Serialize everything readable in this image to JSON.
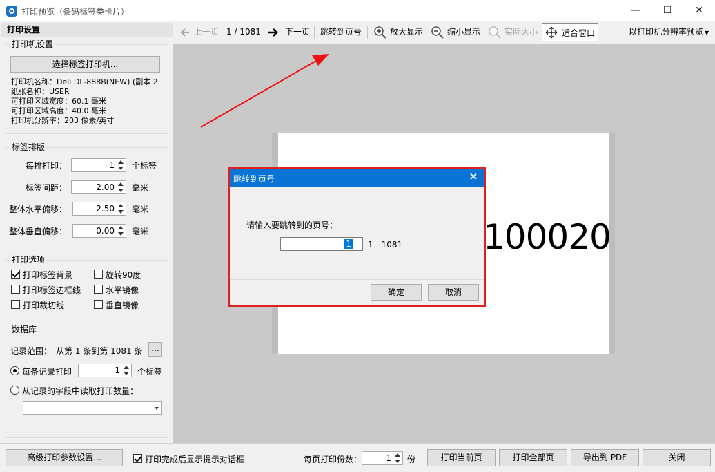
{
  "window": {
    "title": "打印预览（条码标签类卡片）",
    "min": "—",
    "max": "☐",
    "close": "✕"
  },
  "left_panel": {
    "header": "打印设置",
    "printer_group": {
      "title": "打印机设置",
      "select_button": "选择标签打印机...",
      "lines": [
        "打印机名称：Deli DL-888B(NEW) (副本 2",
        "纸张名称：USER",
        "可打印区域宽度：60.1 毫米",
        "可打印区域高度：40.0 毫米",
        "打印机分辨率：203 像素/英寸"
      ]
    },
    "layout_group": {
      "title": "标签排版",
      "rows": [
        {
          "label": "每排打印：",
          "value": "1",
          "unit": "个标签"
        },
        {
          "label": "标签间距：",
          "value": "2.00",
          "unit": "毫米"
        },
        {
          "label": "整体水平偏移：",
          "value": "2.50",
          "unit": "毫米"
        },
        {
          "label": "整体垂直偏移：",
          "value": "0.00",
          "unit": "毫米"
        }
      ]
    },
    "options_group": {
      "title": "打印选项",
      "print_bg": "打印标签背景",
      "print_border": "打印标签边框线",
      "print_cut": "打印裁切线",
      "rotate": "旋转90度",
      "h_mirror": "水平镜像",
      "v_mirror": "垂直镜像"
    },
    "db_group": {
      "title": "数据库",
      "range_label": "记录范围：",
      "range_value": "从第 1 条到第 1081 条",
      "range_more": "...",
      "per_record_label": "每条记录打印",
      "per_record_value": "1",
      "per_record_unit": "个标签",
      "from_field_label": "从记录的字段中读取打印数量："
    }
  },
  "toolbar": {
    "prev": "上一页",
    "page_indicator": "1 / 1081",
    "next": "下一页",
    "goto": "跳转到页号",
    "zoom_in": "放大显示",
    "zoom_out": "缩小显示",
    "actual": "实际大小",
    "fit": "适合窗口",
    "dpi_mode": "以打印机分辨率预览"
  },
  "preview": {
    "label_text": "100020"
  },
  "dialog": {
    "title": "跳转到页号",
    "close": "✕",
    "prompt": "请输入要跳转到的页号：",
    "value": "1",
    "range": "1 - 1081",
    "ok": "确定",
    "cancel": "取消"
  },
  "bottom_bar": {
    "advanced": "高级打印参数设置...",
    "show_dialog": "打印完成后显示提示对话框",
    "copies_label": "每页打印份数：",
    "copies_value": "1",
    "copies_unit": "份",
    "print_current": "打印当前页",
    "print_all": "打印全部页",
    "export_pdf": "导出到 PDF",
    "close": "关闭"
  },
  "colors": {
    "accent": "#0a74d6",
    "highlight": "#e02020"
  }
}
